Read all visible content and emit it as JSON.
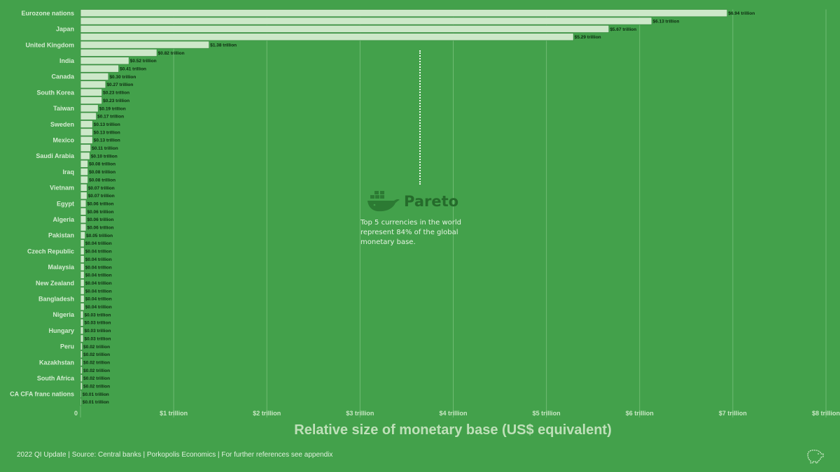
{
  "chart_data": {
    "type": "bar",
    "orientation": "horizontal",
    "categories": [
      "Eurozone nations",
      "",
      "Japan",
      "",
      "United Kingdom",
      "",
      "India",
      "",
      "Canada",
      "",
      "South Korea",
      "",
      "Taiwan",
      "",
      "Sweden",
      "",
      "Mexico",
      "",
      "Saudi Arabia",
      "",
      "Iraq",
      "",
      "Vietnam",
      "",
      "Egypt",
      "",
      "Algeria",
      "",
      "Pakistan",
      "",
      "Czech Republic",
      "",
      "Malaysia",
      "",
      "New Zealand",
      "",
      "Bangladesh",
      "",
      "Nigeria",
      "",
      "Hungary",
      "",
      "Peru",
      "",
      "Kazakhstan",
      "",
      "South Africa",
      "",
      "CA CFA franc nations",
      ""
    ],
    "values": [
      6.94,
      6.13,
      5.67,
      5.29,
      1.38,
      0.82,
      0.52,
      0.41,
      0.3,
      0.27,
      0.23,
      0.23,
      0.19,
      0.17,
      0.13,
      0.13,
      0.13,
      0.11,
      0.1,
      0.08,
      0.08,
      0.08,
      0.07,
      0.07,
      0.06,
      0.06,
      0.06,
      0.06,
      0.05,
      0.04,
      0.04,
      0.04,
      0.04,
      0.04,
      0.04,
      0.04,
      0.04,
      0.04,
      0.03,
      0.03,
      0.03,
      0.03,
      0.02,
      0.02,
      0.02,
      0.02,
      0.02,
      0.02,
      0.01,
      0.01
    ],
    "value_labels": [
      "$6.94 trillion",
      "$6.13 trillion",
      "$5.67 trillion",
      "$5.29 trillion",
      "$1.38 trillion",
      "$0.82 trillion",
      "$0.52 trillion",
      "$0.41 trillion",
      "$0.30 trillion",
      "$0.27 trillion",
      "$0.23 trillion",
      "$0.23 trillion",
      "$0.19 trillion",
      "$0.17 trillion",
      "$0.13 trillion",
      "$0.13 trillion",
      "$0.13 trillion",
      "$0.11 trillion",
      "$0.10 trillion",
      "$0.08 trillion",
      "$0.08 trillion",
      "$0.08 trillion",
      "$0.07 trillion",
      "$0.07 trillion",
      "$0.06 trillion",
      "$0.06 trillion",
      "$0.06 trillion",
      "$0.06 trillion",
      "$0.05 trillion",
      "$0.04 trillion",
      "$0.04 trillion",
      "$0.04 trillion",
      "$0.04 trillion",
      "$0.04 trillion",
      "$0.04 trillion",
      "$0.04 trillion",
      "$0.04 trillion",
      "$0.04 trillion",
      "$0.03 trillion",
      "$0.03 trillion",
      "$0.03 trillion",
      "$0.03 trillion",
      "$0.02 trillion",
      "$0.02 trillion",
      "$0.02 trillion",
      "$0.02 trillion",
      "$0.02 trillion",
      "$0.02 trillion",
      "$0.01 trillion",
      "$0.01 trillion"
    ],
    "x_ticks": [
      0,
      1,
      2,
      3,
      4,
      5,
      6,
      7,
      8
    ],
    "x_tick_labels": [
      "0",
      "$1 trillion",
      "$2 trillion",
      "$3 trillion",
      "$4 trillion",
      "$5 trillion",
      "$6 trillion",
      "$7 trillion",
      "$8 trillion"
    ],
    "xlim": [
      0,
      8
    ],
    "xlabel": "Relative size of monetary base (US$ equivalent)",
    "grid": true,
    "bar_color": "#cde8c9",
    "background_color": "#43a14b"
  },
  "annotation": {
    "text": "Top 5 currencies in the world represent 84% of the global monetary base."
  },
  "logo": {
    "icon": "whale-containers-icon",
    "text": "Pareto"
  },
  "footer": {
    "text": "2022 QI Update | Source: Central banks | Porkopolis Economics | For further references see appendix"
  },
  "corner_icon": "pig-outline-icon"
}
